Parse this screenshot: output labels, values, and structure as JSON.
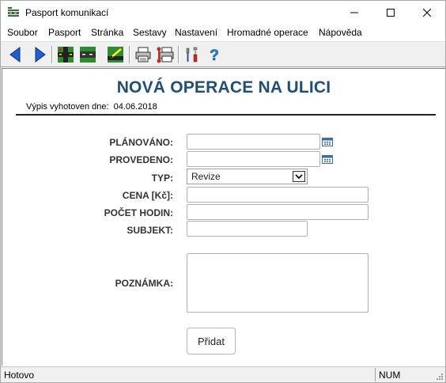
{
  "window": {
    "title": "Pasport komunikací"
  },
  "menu": {
    "items": [
      "Soubor",
      "Pasport",
      "Stránka",
      "Sestavy",
      "Nastavení",
      "Hromadné operace",
      "Nápověda"
    ]
  },
  "toolbar": {
    "buttons": [
      "back-icon",
      "forward-icon",
      "map-icon",
      "section-icon",
      "edit-map-icon",
      "print-icon",
      "print-setup-icon",
      "tools-icon",
      "help-icon"
    ]
  },
  "page": {
    "title": "NOVÁ OPERACE NA ULICI",
    "date_label": "Výpis vyhotoven dne:",
    "date_value": "04.06.2018"
  },
  "form": {
    "planned_label": "PLÁNOVÁNO:",
    "planned_value": "",
    "done_label": "PROVEDENO:",
    "done_value": "",
    "type_label": "TYP:",
    "type_value": "Revize",
    "price_label": "CENA [Kč]:",
    "price_value": "",
    "hours_label": "POČET HODIN:",
    "hours_value": "",
    "subject_label": "SUBJEKT:",
    "subject_value": "",
    "note_label": "POZNÁMKA:",
    "note_value": "",
    "submit_label": "Přidat"
  },
  "status": {
    "text": "Hotovo",
    "num": "NUM"
  },
  "colors": {
    "title": "#1f4e79",
    "calendar_icon": "#3a6ea5"
  }
}
